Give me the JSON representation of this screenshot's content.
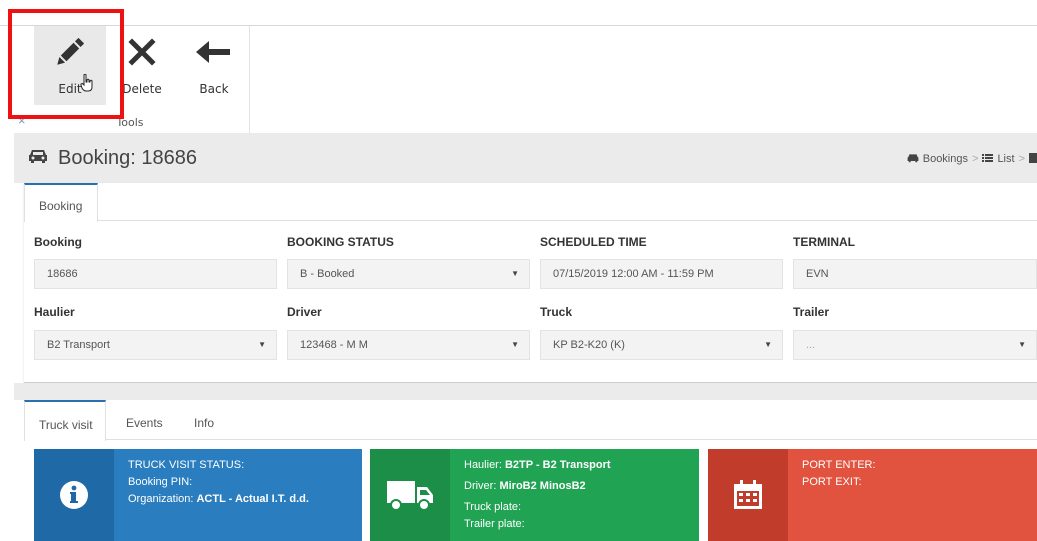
{
  "ribbon": {
    "buttons": [
      {
        "label": "Edit",
        "icon": "pencil-icon"
      },
      {
        "label": "Delete",
        "icon": "close-icon"
      },
      {
        "label": "Back",
        "icon": "arrow-left-icon"
      }
    ],
    "group_label": "Tools",
    "collapse_glyph": "×"
  },
  "header": {
    "title": "Booking: 18686",
    "icon": "car-icon",
    "breadcrumb": [
      {
        "label": "Bookings",
        "icon": "car-icon"
      },
      {
        "label": "List",
        "icon": "list-icon"
      }
    ]
  },
  "booking": {
    "tab": "Booking",
    "fields": [
      {
        "label": "Booking",
        "value": "18686",
        "dropdown": false
      },
      {
        "label": "BOOKING STATUS",
        "value": "B - Booked",
        "dropdown": true
      },
      {
        "label": "SCHEDULED TIME",
        "value": "07/15/2019 12:00 AM - 11:59 PM",
        "dropdown": false
      },
      {
        "label": "TERMINAL",
        "value": "EVN",
        "dropdown": false
      },
      {
        "label": "Haulier",
        "value": "B2 Transport",
        "dropdown": true
      },
      {
        "label": "Driver",
        "value": "123468 - M M",
        "dropdown": true
      },
      {
        "label": "Truck",
        "value": "KP B2-K20 (K)",
        "dropdown": true
      },
      {
        "label": "Trailer",
        "value": "...",
        "dropdown": true
      }
    ]
  },
  "lower": {
    "tabs": [
      "Truck visit",
      "Events",
      "Info"
    ],
    "tiles": {
      "status": {
        "icon": "info-icon",
        "line1": "TRUCK VISIT STATUS:",
        "line2": "Booking PIN:",
        "line3_label": "Organization: ",
        "line3_value": "ACTL - Actual I.T. d.d."
      },
      "vehicle": {
        "icon": "truck-icon",
        "haulier_label": "Haulier: ",
        "haulier_value": "B2TP - B2 Transport",
        "driver_label": "Driver: ",
        "driver_value": "MiroB2 MinosB2",
        "truck_plate": "Truck plate:",
        "trailer_plate": "Trailer plate:"
      },
      "port": {
        "icon": "calendar-icon",
        "line1": "PORT ENTER:",
        "line2": "PORT EXIT:"
      }
    }
  },
  "colors": {
    "accent": "#2c6fad",
    "highlight": "#ee1111",
    "tile_blue": "#2a7dbf",
    "tile_green": "#21a354",
    "tile_red": "#e2533f"
  }
}
